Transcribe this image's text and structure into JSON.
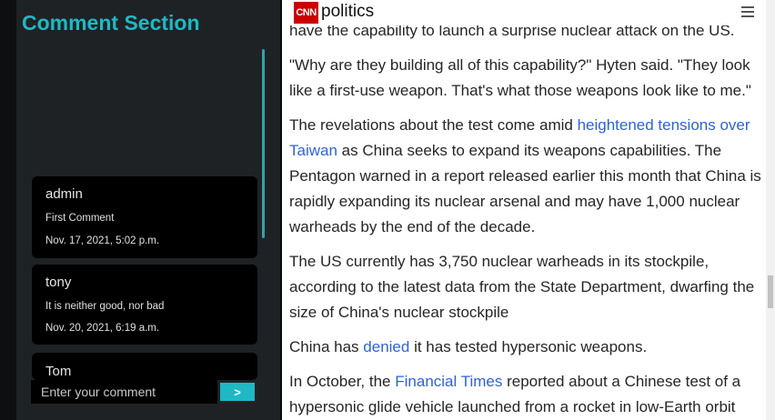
{
  "comments_panel": {
    "title": "Comment Section",
    "comments": [
      {
        "author": "admin",
        "text": "First Comment",
        "date": "Nov. 17, 2021, 5:02 p.m."
      },
      {
        "author": "tony",
        "text": "It is neither good, nor bad",
        "date": "Nov. 20, 2021, 6:19 a.m."
      },
      {
        "author": "Tom"
      }
    ],
    "input": {
      "placeholder": "Enter your comment",
      "value": ""
    },
    "send_label": ">"
  },
  "header": {
    "logo_text": "CNN",
    "section": "politics",
    "menu_icon": "hamburger-menu-icon"
  },
  "article": {
    "p0": "have the capability to launch a surprise nuclear attack on the US.",
    "p1": "\"Why are they building all of this capability?\" Hyten said. \"They look like a first-use weapon. That's what those weapons look like to me.\"",
    "p2": {
      "before": "The revelations about the test come amid ",
      "link": "heightened tensions over Taiwan",
      "after": " as China seeks to expand its weapons capabilities. The Pentagon warned in a report released earlier this month that China is rapidly expanding its nuclear arsenal and may have 1,000 nuclear warheads by the end of the decade."
    },
    "p3": "The US currently has 3,750 nuclear warheads in its stockpile, according to the latest data from the State Department, dwarfing the size of China's nuclear stockpile",
    "p4": {
      "before": "China has ",
      "link": "denied",
      "after": " it has tested hypersonic weapons."
    },
    "p5": {
      "before": "In October, the ",
      "link": "Financial Times",
      "after": " reported about a Chinese test of a hypersonic glide vehicle launched from a rocket in low-Earth orbit"
    }
  },
  "colors": {
    "accent": "#1fb8c5",
    "panel_bg": "#1e2224",
    "card_bg": "#000000",
    "link": "#2d63d8",
    "brand_red": "#cc0000"
  }
}
